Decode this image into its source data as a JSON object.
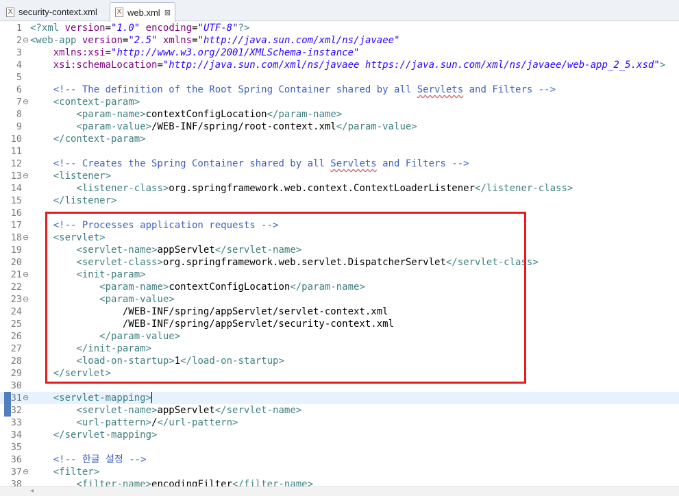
{
  "tabs": [
    {
      "label": "security-context.xml",
      "icon": "xml-file-icon",
      "active": false
    },
    {
      "label": "web.xml",
      "icon": "xml-file-icon",
      "active": true,
      "close": "⊠"
    }
  ],
  "colors": {
    "tag": "#3f7f7f",
    "attribute": "#7f007f",
    "string": "#2a00ff",
    "comment": "#3f5fbf",
    "text": "#000000",
    "line_number": "#787878",
    "current_line": "#e8f2fe",
    "highlight_box": "#e31b23"
  },
  "lines": [
    {
      "n": "1",
      "fold": "",
      "tokens": [
        [
          "t",
          "<?"
        ],
        [
          "t",
          "xml"
        ],
        [
          "x",
          " "
        ],
        [
          "a",
          "version"
        ],
        [
          "x",
          "="
        ],
        [
          "s",
          "\"1.0\""
        ],
        [
          "x",
          " "
        ],
        [
          "a",
          "encoding"
        ],
        [
          "x",
          "="
        ],
        [
          "s",
          "\"UTF-8\""
        ],
        [
          "t",
          "?>"
        ]
      ]
    },
    {
      "n": "2",
      "fold": "⊖",
      "tokens": [
        [
          "t",
          "<web-app"
        ],
        [
          "x",
          " "
        ],
        [
          "a",
          "version"
        ],
        [
          "x",
          "="
        ],
        [
          "s",
          "\"2.5\""
        ],
        [
          "x",
          " "
        ],
        [
          "a",
          "xmlns"
        ],
        [
          "x",
          "="
        ],
        [
          "s",
          "\"http://java.sun.com/xml/ns/javaee\""
        ]
      ]
    },
    {
      "n": "3",
      "fold": "",
      "tokens": [
        [
          "x",
          "    "
        ],
        [
          "a",
          "xmlns:xsi"
        ],
        [
          "x",
          "="
        ],
        [
          "s",
          "\"http://www.w3.org/2001/XMLSchema-instance\""
        ]
      ]
    },
    {
      "n": "4",
      "fold": "",
      "tokens": [
        [
          "x",
          "    "
        ],
        [
          "a",
          "xsi:schemaLocation"
        ],
        [
          "x",
          "="
        ],
        [
          "s",
          "\"http://java.sun.com/xml/ns/javaee https://java.sun.com/xml/ns/javaee/web-app_2_5.xsd\""
        ],
        [
          "t",
          ">"
        ]
      ]
    },
    {
      "n": "5",
      "fold": "",
      "tokens": []
    },
    {
      "n": "6",
      "fold": "",
      "tokens": [
        [
          "x",
          "    "
        ],
        [
          "c",
          "<!-- The definition of the Root Spring Container shared by all "
        ],
        [
          "cs",
          "Servlets"
        ],
        [
          "c",
          " and Filters -->"
        ]
      ]
    },
    {
      "n": "7",
      "fold": "⊖",
      "tokens": [
        [
          "x",
          "    "
        ],
        [
          "t",
          "<context-param>"
        ]
      ]
    },
    {
      "n": "8",
      "fold": "",
      "tokens": [
        [
          "x",
          "        "
        ],
        [
          "t",
          "<param-name>"
        ],
        [
          "x",
          "contextConfigLocation"
        ],
        [
          "t",
          "</param-name>"
        ]
      ]
    },
    {
      "n": "9",
      "fold": "",
      "tokens": [
        [
          "x",
          "        "
        ],
        [
          "t",
          "<param-value>"
        ],
        [
          "x",
          "/WEB-INF/spring/root-context.xml"
        ],
        [
          "t",
          "</param-value>"
        ]
      ]
    },
    {
      "n": "10",
      "fold": "",
      "tokens": [
        [
          "x",
          "    "
        ],
        [
          "t",
          "</context-param>"
        ]
      ]
    },
    {
      "n": "11",
      "fold": "",
      "tokens": []
    },
    {
      "n": "12",
      "fold": "",
      "tokens": [
        [
          "x",
          "    "
        ],
        [
          "c",
          "<!-- Creates the Spring Container shared by all "
        ],
        [
          "cs",
          "Servlets"
        ],
        [
          "c",
          " and Filters -->"
        ]
      ]
    },
    {
      "n": "13",
      "fold": "⊖",
      "tokens": [
        [
          "x",
          "    "
        ],
        [
          "t",
          "<listener>"
        ]
      ]
    },
    {
      "n": "14",
      "fold": "",
      "tokens": [
        [
          "x",
          "        "
        ],
        [
          "t",
          "<listener-class>"
        ],
        [
          "x",
          "org.springframework.web.context.ContextLoaderListener"
        ],
        [
          "t",
          "</listener-class>"
        ]
      ]
    },
    {
      "n": "15",
      "fold": "",
      "tokens": [
        [
          "x",
          "    "
        ],
        [
          "t",
          "</listener>"
        ]
      ]
    },
    {
      "n": "16",
      "fold": "",
      "tokens": []
    },
    {
      "n": "17",
      "fold": "",
      "tokens": [
        [
          "x",
          "    "
        ],
        [
          "c",
          "<!-- Processes application requests -->"
        ]
      ]
    },
    {
      "n": "18",
      "fold": "⊖",
      "tokens": [
        [
          "x",
          "    "
        ],
        [
          "t",
          "<servlet>"
        ]
      ]
    },
    {
      "n": "19",
      "fold": "",
      "tokens": [
        [
          "x",
          "        "
        ],
        [
          "t",
          "<servlet-name>"
        ],
        [
          "x",
          "appServlet"
        ],
        [
          "t",
          "</servlet-name>"
        ]
      ]
    },
    {
      "n": "20",
      "fold": "",
      "tokens": [
        [
          "x",
          "        "
        ],
        [
          "t",
          "<servlet-class>"
        ],
        [
          "x",
          "org.springframework.web.servlet.DispatcherServlet"
        ],
        [
          "t",
          "</servlet-class>"
        ]
      ]
    },
    {
      "n": "21",
      "fold": "⊖",
      "tokens": [
        [
          "x",
          "        "
        ],
        [
          "t",
          "<init-param>"
        ]
      ]
    },
    {
      "n": "22",
      "fold": "",
      "tokens": [
        [
          "x",
          "            "
        ],
        [
          "t",
          "<param-name>"
        ],
        [
          "x",
          "contextConfigLocation"
        ],
        [
          "t",
          "</param-name>"
        ]
      ]
    },
    {
      "n": "23",
      "fold": "⊖",
      "tokens": [
        [
          "x",
          "            "
        ],
        [
          "t",
          "<param-value>"
        ]
      ]
    },
    {
      "n": "24",
      "fold": "",
      "tokens": [
        [
          "x",
          "                /WEB-INF/spring/appServlet/servlet-context.xml"
        ]
      ]
    },
    {
      "n": "25",
      "fold": "",
      "tokens": [
        [
          "x",
          "                /WEB-INF/spring/appServlet/security-context.xml"
        ]
      ]
    },
    {
      "n": "26",
      "fold": "",
      "tokens": [
        [
          "x",
          "            "
        ],
        [
          "t",
          "</param-value>"
        ]
      ]
    },
    {
      "n": "27",
      "fold": "",
      "tokens": [
        [
          "x",
          "        "
        ],
        [
          "t",
          "</init-param>"
        ]
      ]
    },
    {
      "n": "28",
      "fold": "",
      "tokens": [
        [
          "x",
          "        "
        ],
        [
          "t",
          "<load-on-startup>"
        ],
        [
          "x",
          "1"
        ],
        [
          "t",
          "</load-on-startup>"
        ]
      ]
    },
    {
      "n": "29",
      "fold": "",
      "tokens": [
        [
          "x",
          "    "
        ],
        [
          "t",
          "</servlet>"
        ]
      ]
    },
    {
      "n": "30",
      "fold": "",
      "tokens": []
    },
    {
      "n": "31",
      "fold": "⊖",
      "current": true,
      "tokens": [
        [
          "x",
          "    "
        ],
        [
          "t",
          "<servlet-mapping>"
        ],
        [
          "caret",
          ""
        ]
      ]
    },
    {
      "n": "32",
      "fold": "",
      "tokens": [
        [
          "x",
          "        "
        ],
        [
          "t",
          "<servlet-name>"
        ],
        [
          "x",
          "appServlet"
        ],
        [
          "t",
          "</servlet-name>"
        ]
      ]
    },
    {
      "n": "33",
      "fold": "",
      "tokens": [
        [
          "x",
          "        "
        ],
        [
          "t",
          "<url-pattern>"
        ],
        [
          "x",
          "/"
        ],
        [
          "t",
          "</url-pattern>"
        ]
      ]
    },
    {
      "n": "34",
      "fold": "",
      "tokens": [
        [
          "x",
          "    "
        ],
        [
          "t",
          "</servlet-mapping>"
        ]
      ]
    },
    {
      "n": "35",
      "fold": "",
      "tokens": []
    },
    {
      "n": "36",
      "fold": "",
      "tokens": [
        [
          "x",
          "    "
        ],
        [
          "c",
          "<!-- 한글 설정 -->"
        ]
      ]
    },
    {
      "n": "37",
      "fold": "⊖",
      "tokens": [
        [
          "x",
          "    "
        ],
        [
          "t",
          "<filter>"
        ]
      ]
    },
    {
      "n": "38",
      "fold": "",
      "tokens": [
        [
          "x",
          "        "
        ],
        [
          "t",
          "<filter-name>"
        ],
        [
          "x",
          "encodingFilter"
        ],
        [
          "t",
          "</filter-name>"
        ]
      ]
    }
  ]
}
